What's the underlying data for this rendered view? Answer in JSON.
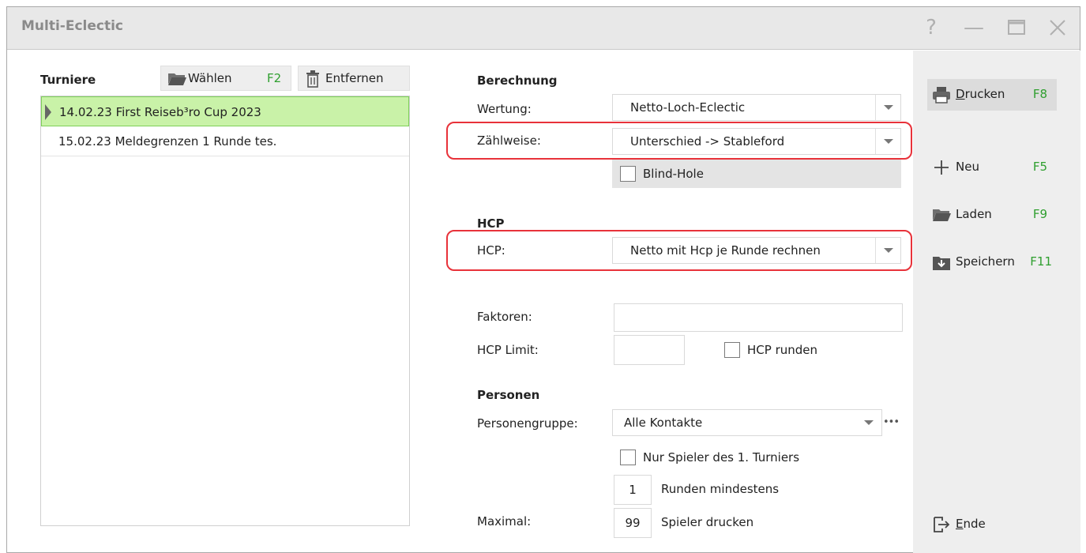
{
  "window": {
    "title": "Multi-Eclectic",
    "help": "?",
    "minimize": "—",
    "maximize": "▢",
    "close": "✕"
  },
  "tournaments": {
    "label": "Turniere",
    "choose_label": "Wählen",
    "choose_key": "F2",
    "remove_label": "Entfernen",
    "items": [
      {
        "label": "14.02.23 First Reiseb³ro Cup 2023",
        "selected": true
      },
      {
        "label": "15.02.23 Meldegrenzen 1 Runde tes.",
        "selected": false
      }
    ]
  },
  "calc": {
    "heading": "Berechnung",
    "wertung_label": "Wertung:",
    "wertung_value": "Netto-Loch-Eclectic",
    "zaehlweise_label": "Zählweise:",
    "zaehlweise_value": "Unterschied -> Stableford",
    "blind_hole_label": "Blind-Hole",
    "blind_hole_checked": false
  },
  "hcp": {
    "heading": "HCP",
    "hcp_label": "HCP:",
    "hcp_value": "Netto mit Hcp je Runde rechnen",
    "faktoren_label": "Faktoren:",
    "faktoren_value": "",
    "limit_label": "HCP Limit:",
    "limit_value": "",
    "runden_label": "HCP runden",
    "runden_checked": false
  },
  "persons": {
    "heading": "Personen",
    "group_label": "Personengruppe:",
    "group_value": "Alle Kontakte",
    "more_label": "•••",
    "only_first_label": "Nur Spieler des 1. Turniers",
    "only_first_checked": false,
    "rounds_min_value": "1",
    "rounds_min_label": "Runden mindestens",
    "max_label": "Maximal:",
    "max_value": "99",
    "max_suffix": "Spieler drucken"
  },
  "sidebar": {
    "print": {
      "label_u": "D",
      "label_rest": "rucken",
      "key": "F8"
    },
    "new": {
      "label": "Neu",
      "key": "F5"
    },
    "load": {
      "label": "Laden",
      "key": "F9"
    },
    "save": {
      "label": "Speichern",
      "key": "F11"
    },
    "end": {
      "label_u": "E",
      "label_rest": "nde"
    }
  },
  "colors": {
    "accent_green": "#2f9f2f",
    "highlight_red": "#e8323a",
    "selected_row": "#c9f2a8"
  }
}
